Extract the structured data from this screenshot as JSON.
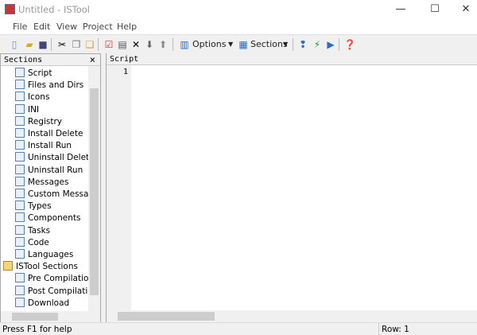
{
  "window": {
    "title": "Untitled - ISTool",
    "minimize": "—",
    "maximize": "☐",
    "close": "✕"
  },
  "menu": [
    "File",
    "Edit",
    "View",
    "Project",
    "Help"
  ],
  "toolbar": {
    "options_label": "Options",
    "sections_label": "Sections"
  },
  "sections_panel": {
    "title": "Sections",
    "close": "×",
    "items": [
      {
        "label": "Script",
        "icon": "script-icon",
        "level": 1
      },
      {
        "label": "Files and Dirs",
        "icon": "files-icon",
        "level": 1
      },
      {
        "label": "Icons",
        "icon": "icons-icon",
        "level": 1
      },
      {
        "label": "INI",
        "icon": "ini-icon",
        "level": 1
      },
      {
        "label": "Registry",
        "icon": "registry-icon",
        "level": 1
      },
      {
        "label": "Install Delete",
        "icon": "install-delete-icon",
        "level": 1
      },
      {
        "label": "Install Run",
        "icon": "install-run-icon",
        "level": 1
      },
      {
        "label": "Uninstall Delete",
        "icon": "uninstall-delete-icon",
        "level": 1
      },
      {
        "label": "Uninstall Run",
        "icon": "uninstall-run-icon",
        "level": 1
      },
      {
        "label": "Messages",
        "icon": "messages-icon",
        "level": 1
      },
      {
        "label": "Custom Messages",
        "icon": "custom-messages-icon",
        "level": 1
      },
      {
        "label": "Types",
        "icon": "types-icon",
        "level": 1
      },
      {
        "label": "Components",
        "icon": "components-icon",
        "level": 1
      },
      {
        "label": "Tasks",
        "icon": "tasks-icon",
        "level": 1
      },
      {
        "label": "Code",
        "icon": "code-icon",
        "level": 1
      },
      {
        "label": "Languages",
        "icon": "languages-icon",
        "level": 1
      },
      {
        "label": "ISTool Sections",
        "icon": "folder-icon",
        "level": 0
      },
      {
        "label": "Pre Compilation Steps",
        "icon": "pre-compilation-icon",
        "level": 1
      },
      {
        "label": "Post Compilation",
        "icon": "post-compilation-icon",
        "level": 1
      },
      {
        "label": "Download",
        "icon": "download-icon",
        "level": 1
      }
    ]
  },
  "editor": {
    "title": "Script",
    "line_numbers": [
      "1"
    ]
  },
  "status": {
    "help": "Press F1 for help",
    "row": "Row: 1"
  }
}
